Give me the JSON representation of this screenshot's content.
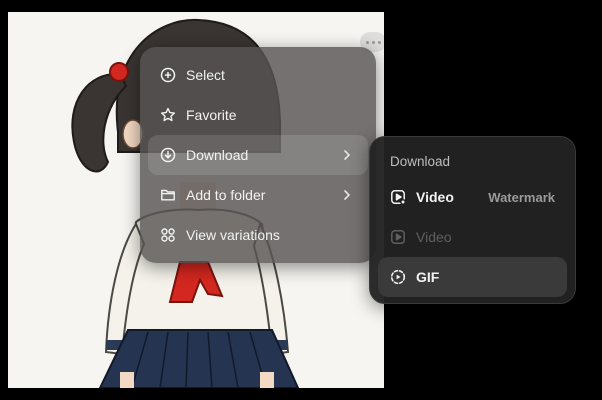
{
  "context_menu": {
    "items": [
      {
        "label": "Select",
        "icon": "plus-circle-icon"
      },
      {
        "label": "Favorite",
        "icon": "star-icon"
      },
      {
        "label": "Download",
        "icon": "download-circle-icon"
      },
      {
        "label": "Add to folder",
        "icon": "folder-icon"
      },
      {
        "label": "View variations",
        "icon": "grid-circles-icon"
      }
    ]
  },
  "download_submenu": {
    "title": "Download",
    "items": [
      {
        "label": "Video",
        "badge": "Watermark",
        "icon": "video-play-icon"
      },
      {
        "label": "Video",
        "icon": "video-play-icon",
        "disabled": true
      },
      {
        "label": "GIF",
        "icon": "gif-dashed-circle-icon"
      }
    ]
  },
  "colors": {
    "menu_bg": "#585454",
    "submenu_bg": "#222222",
    "text": "#f2f2f2"
  }
}
